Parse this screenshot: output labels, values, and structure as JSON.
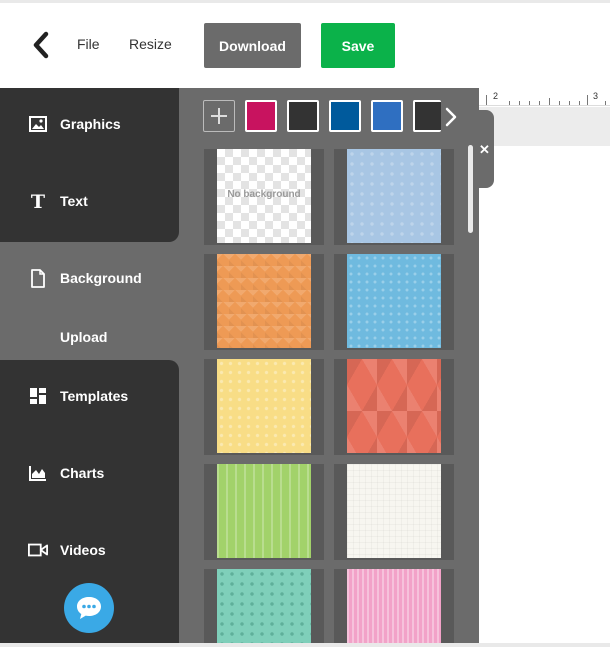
{
  "header": {
    "file_label": "File",
    "resize_label": "Resize",
    "download_label": "Download",
    "save_label": "Save",
    "colors": {
      "download_bg": "#6b6b6b",
      "save_bg": "#0bb24a"
    }
  },
  "sidebar": {
    "items": [
      {
        "label": "Graphics",
        "icon": "image-icon"
      },
      {
        "label": "Text",
        "icon": "text-icon"
      },
      {
        "label": "Background",
        "icon": "file-icon",
        "active": true
      },
      {
        "label": "Templates",
        "icon": "templates-grid-icon"
      },
      {
        "label": "Charts",
        "icon": "area-chart-icon"
      },
      {
        "label": "Videos",
        "icon": "video-camera-icon"
      }
    ],
    "upload_label": "Upload",
    "chat_icon": "chat-bubble-icon"
  },
  "panel": {
    "swatches": [
      "#c8135f",
      "#333333",
      "#005a9c",
      "#2f6fc1",
      "#333333"
    ],
    "no_background_label": "No background",
    "tiles": [
      {
        "name": "no-background",
        "pattern": "checker"
      },
      {
        "name": "light-blue-dots",
        "color": "#a8c6e4"
      },
      {
        "name": "orange-zigzag",
        "color": "#ee9a55"
      },
      {
        "name": "sky-blue-dots",
        "color": "#6fbadf"
      },
      {
        "name": "yellow-dots",
        "color": "#f8dd86"
      },
      {
        "name": "coral-triangles",
        "color": "#e8705c"
      },
      {
        "name": "green-stripes",
        "color": "#a2d26a"
      },
      {
        "name": "off-white-grid",
        "color": "#f7f6f0"
      },
      {
        "name": "teal-dots",
        "color": "#7fcfba"
      },
      {
        "name": "pink-stripes",
        "color": "#f2a2c8"
      }
    ]
  },
  "ruler": {
    "label_2": "2",
    "label_3": "3"
  }
}
